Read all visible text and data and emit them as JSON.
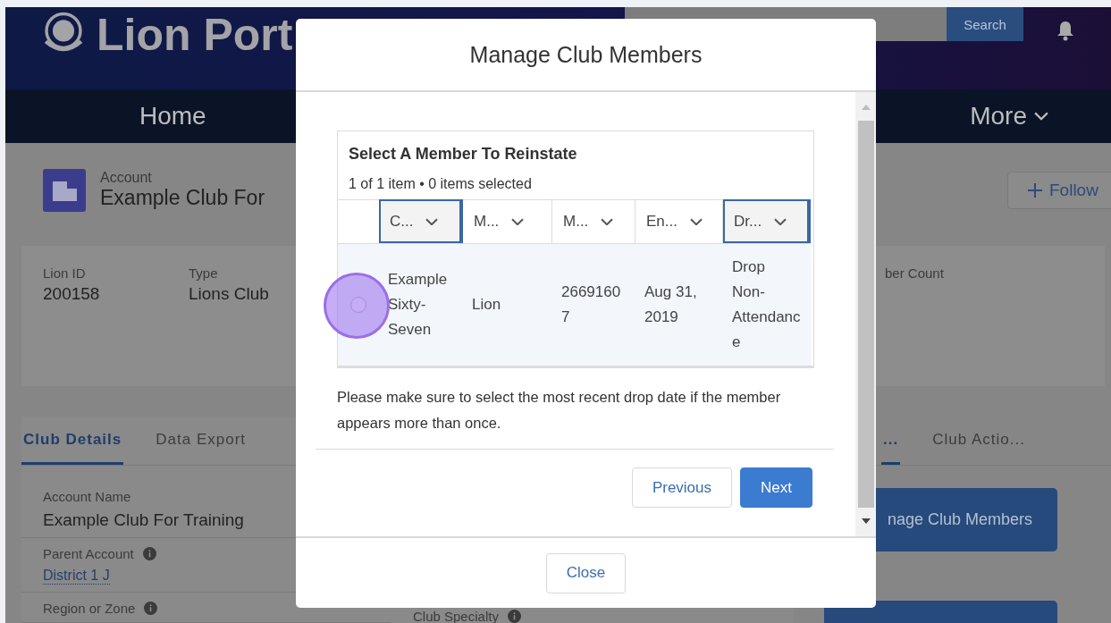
{
  "header": {
    "logo_text": "Lion Port",
    "search_button": "Search"
  },
  "nav": {
    "items": [
      {
        "label": "Home",
        "menu": false
      },
      {
        "label": "More",
        "menu": true
      }
    ]
  },
  "record": {
    "object_type": "Account",
    "name": "Example Club For",
    "follow_button": "Follow"
  },
  "highlights": [
    {
      "label": "Lion ID",
      "value": "200158"
    },
    {
      "label": "Type",
      "value": "Lions Club"
    }
  ],
  "highlights_right": {
    "label": "ber Count"
  },
  "tabs": [
    {
      "label": "Club Details",
      "selected": true
    },
    {
      "label": "Data Export",
      "selected": false
    }
  ],
  "right_tabs": [
    {
      "label": "...",
      "selected": true
    },
    {
      "label": "Club Actio...",
      "selected": false
    }
  ],
  "details": [
    {
      "label": "Account Name",
      "info": false,
      "value": "Example Club For Training",
      "kind": "text"
    },
    {
      "label": "Parent Account",
      "info": true,
      "value": "District 1 J",
      "kind": "link"
    },
    {
      "label": "Region or Zone",
      "info": true,
      "kind": "empty"
    }
  ],
  "details_side": {
    "label": "Club Specialty",
    "info": true
  },
  "actions": [
    "nage Club Members"
  ],
  "modal": {
    "title": "Manage Club Members",
    "table": {
      "title": "Select A Member To Reinstate",
      "count": "1 of 1 item • 0 items selected",
      "columns": [
        {
          "label": "C...",
          "focused": true
        },
        {
          "label": "M...",
          "focused": false
        },
        {
          "label": "M...",
          "focused": false
        },
        {
          "label": "En...",
          "focused": false
        },
        {
          "label": "Dr...",
          "focused": true
        }
      ],
      "rows": [
        {
          "selected": false,
          "cells": [
            "Example Sixty-Seven",
            "Lion",
            "26691607",
            "Aug 31, 2019",
            "Drop Non-Attendance"
          ]
        }
      ]
    },
    "note": "Please make sure to select the most recent drop date if the member appears more than once.",
    "buttons": [
      {
        "label": "Previous",
        "kind": "neutral"
      },
      {
        "label": "Next",
        "kind": "brand"
      }
    ],
    "close_button": "Close"
  }
}
